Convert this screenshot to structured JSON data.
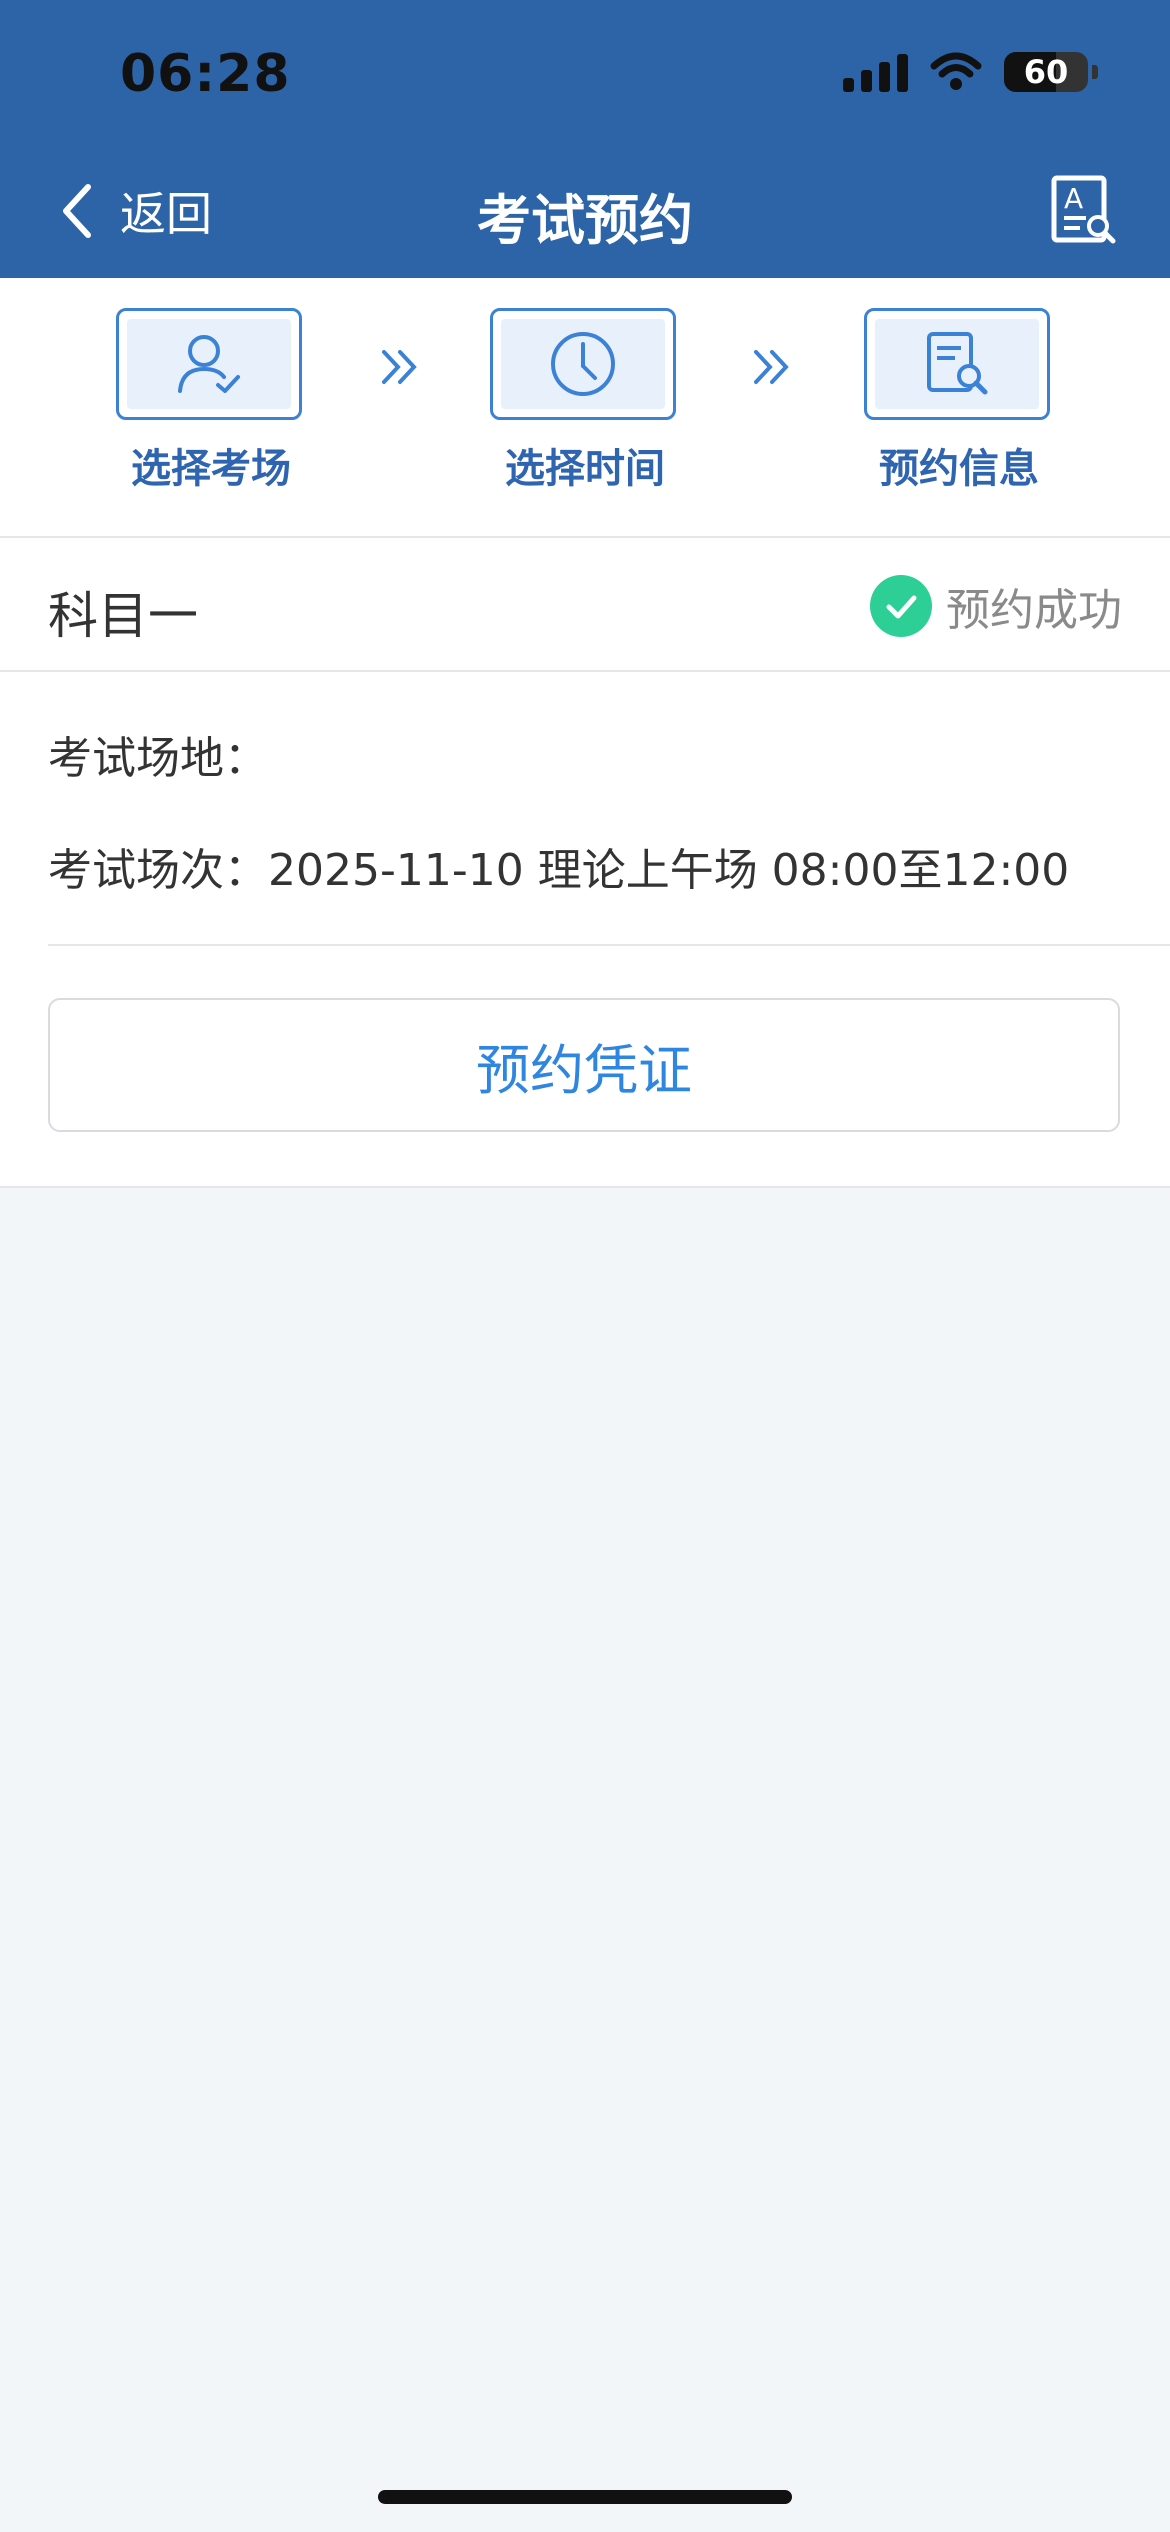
{
  "status_bar": {
    "time": "06:28",
    "battery": "60"
  },
  "nav": {
    "back_label": "返回",
    "title": "考试预约",
    "right_icon": "document-search-icon"
  },
  "steps": [
    {
      "label": "选择考场",
      "icon": "user-check-icon"
    },
    {
      "label": "选择时间",
      "icon": "clock-icon"
    },
    {
      "label": "预约信息",
      "icon": "document-search-icon"
    }
  ],
  "subject": {
    "name": "科目一",
    "status": "预约成功",
    "status_color": "#2ecf96"
  },
  "info": {
    "venue_label": "考试场地：",
    "venue_value": "",
    "session_label": "考试场次：",
    "session_value": "2025-11-10 理论上午场 08:00至12:00"
  },
  "voucher_button": "预约凭证",
  "colors": {
    "header": "#2d64a8",
    "accent": "#3b82d6",
    "link": "#2f86e0"
  }
}
